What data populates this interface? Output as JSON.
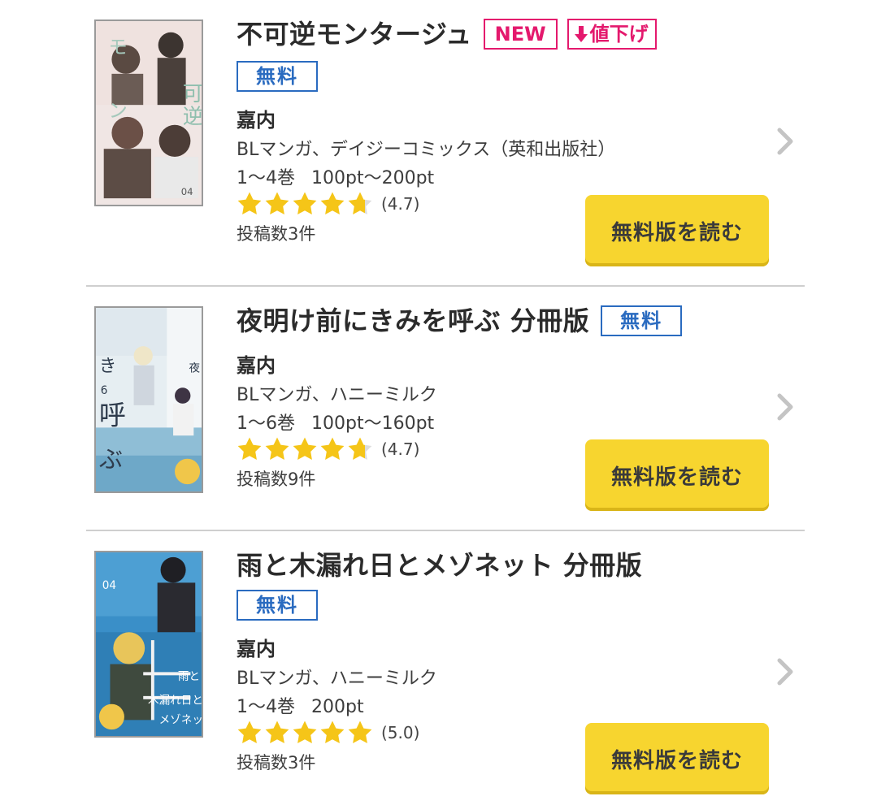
{
  "items": [
    {
      "title": "不可逆モンタージュ",
      "badge_new": "NEW",
      "badge_price_down": "値下げ",
      "badge_free": "無料",
      "author": "嘉内",
      "genre": "BLマンガ、デイジーコミックス（英和出版社）",
      "volumes": "1〜4巻",
      "price": "100pt〜200pt",
      "rating": 4.7,
      "rating_text": "(4.7)",
      "posts": "投稿数3件",
      "read_label": "無料版を読む",
      "cover_colors": [
        "#f4e8e6",
        "#5a4a42",
        "#9bbab0"
      ]
    },
    {
      "title": "夜明け前にきみを呼ぶ 分冊版",
      "badge_free": "無料",
      "author": "嘉内",
      "genre": "BLマンガ、ハニーミルク",
      "volumes": "1〜6巻",
      "price": "100pt〜160pt",
      "rating": 4.7,
      "rating_text": "(4.7)",
      "posts": "投稿数9件",
      "read_label": "無料版を読む",
      "cover_colors": [
        "#e6eef2",
        "#3e4a5a",
        "#9cc7dd"
      ]
    },
    {
      "title": "雨と木漏れ日とメゾネット 分冊版",
      "badge_free": "無料",
      "author": "嘉内",
      "genre": "BLマンガ、ハニーミルク",
      "volumes": "1〜4巻",
      "price": "200pt",
      "rating": 5.0,
      "rating_text": "(5.0)",
      "posts": "投稿数3件",
      "read_label": "無料版を読む",
      "cover_colors": [
        "#3a8fc8",
        "#2a2a2a",
        "#e8c55a"
      ]
    }
  ],
  "colors": {
    "button": "#f7d52f",
    "star": "#f5c518",
    "star_empty": "#dddddd",
    "badge_pink": "#e4196d",
    "badge_blue": "#2a6bc0"
  },
  "icons": {
    "chevron": "chevron-right-icon",
    "star": "star-icon",
    "arrow_down": "arrow-down-icon"
  }
}
